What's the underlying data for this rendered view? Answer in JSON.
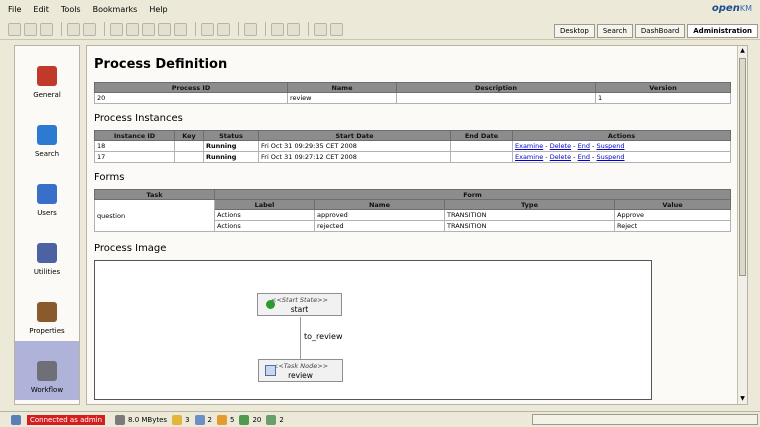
{
  "menu": [
    "File",
    "Edit",
    "Tools",
    "Bookmarks",
    "Help"
  ],
  "logo": {
    "open": "open",
    "km": "KM"
  },
  "tabs": [
    "Desktop",
    "Search",
    "DashBoard",
    "Administration"
  ],
  "sidebar": [
    {
      "label": "General",
      "icon": "house-icon",
      "color": "#c0392b"
    },
    {
      "label": "Search",
      "icon": "search-icon",
      "color": "#2c7bd0"
    },
    {
      "label": "Users",
      "icon": "users-icon",
      "color": "#3a6fc9"
    },
    {
      "label": "Utilities",
      "icon": "utilities-icon",
      "color": "#4d62a3"
    },
    {
      "label": "Properties",
      "icon": "properties-icon",
      "color": "#8a5a2c"
    },
    {
      "label": "Workflow",
      "icon": "workflow-icon",
      "color": "#6f6f78"
    }
  ],
  "page_title": "Process Definition",
  "definition": {
    "headers": [
      "Process ID",
      "Name",
      "Description",
      "Version"
    ],
    "row": [
      "20",
      "review",
      "",
      "1"
    ]
  },
  "instances_title": "Process Instances",
  "instances": {
    "headers": [
      "Instance ID",
      "Key",
      "Status",
      "Start Date",
      "End Date",
      "Actions"
    ],
    "rows": [
      {
        "id": "18",
        "key": "",
        "status": "Running",
        "start": "Fri Oct 31 09:29:35 CET 2008",
        "end": ""
      },
      {
        "id": "17",
        "key": "",
        "status": "Running",
        "start": "Fri Oct 31 09:27:12 CET 2008",
        "end": ""
      }
    ],
    "actions": [
      "Examine",
      "Delete",
      "End",
      "Suspend"
    ],
    "sep": "-"
  },
  "forms_title": "Forms",
  "forms": {
    "headers": [
      "Task",
      "Form"
    ],
    "subheaders": [
      "Label",
      "Name",
      "Type",
      "Value"
    ],
    "task": "question",
    "rows": [
      [
        "Actions",
        "approved",
        "TRANSITION",
        "Approve"
      ],
      [
        "Actions",
        "rejected",
        "TRANSITION",
        "Reject"
      ]
    ]
  },
  "image_title": "Process Image",
  "diagram": {
    "start_stereotype": "<<Start State>>",
    "start_name": "start",
    "transition": "to_review",
    "task_stereotype": "<<Task Node>>",
    "task_name": "review"
  },
  "status": {
    "connected": "Connected as admin",
    "memory": "8.0 MBytes",
    "counts": [
      "3",
      "2",
      "5",
      "20",
      "2"
    ]
  }
}
